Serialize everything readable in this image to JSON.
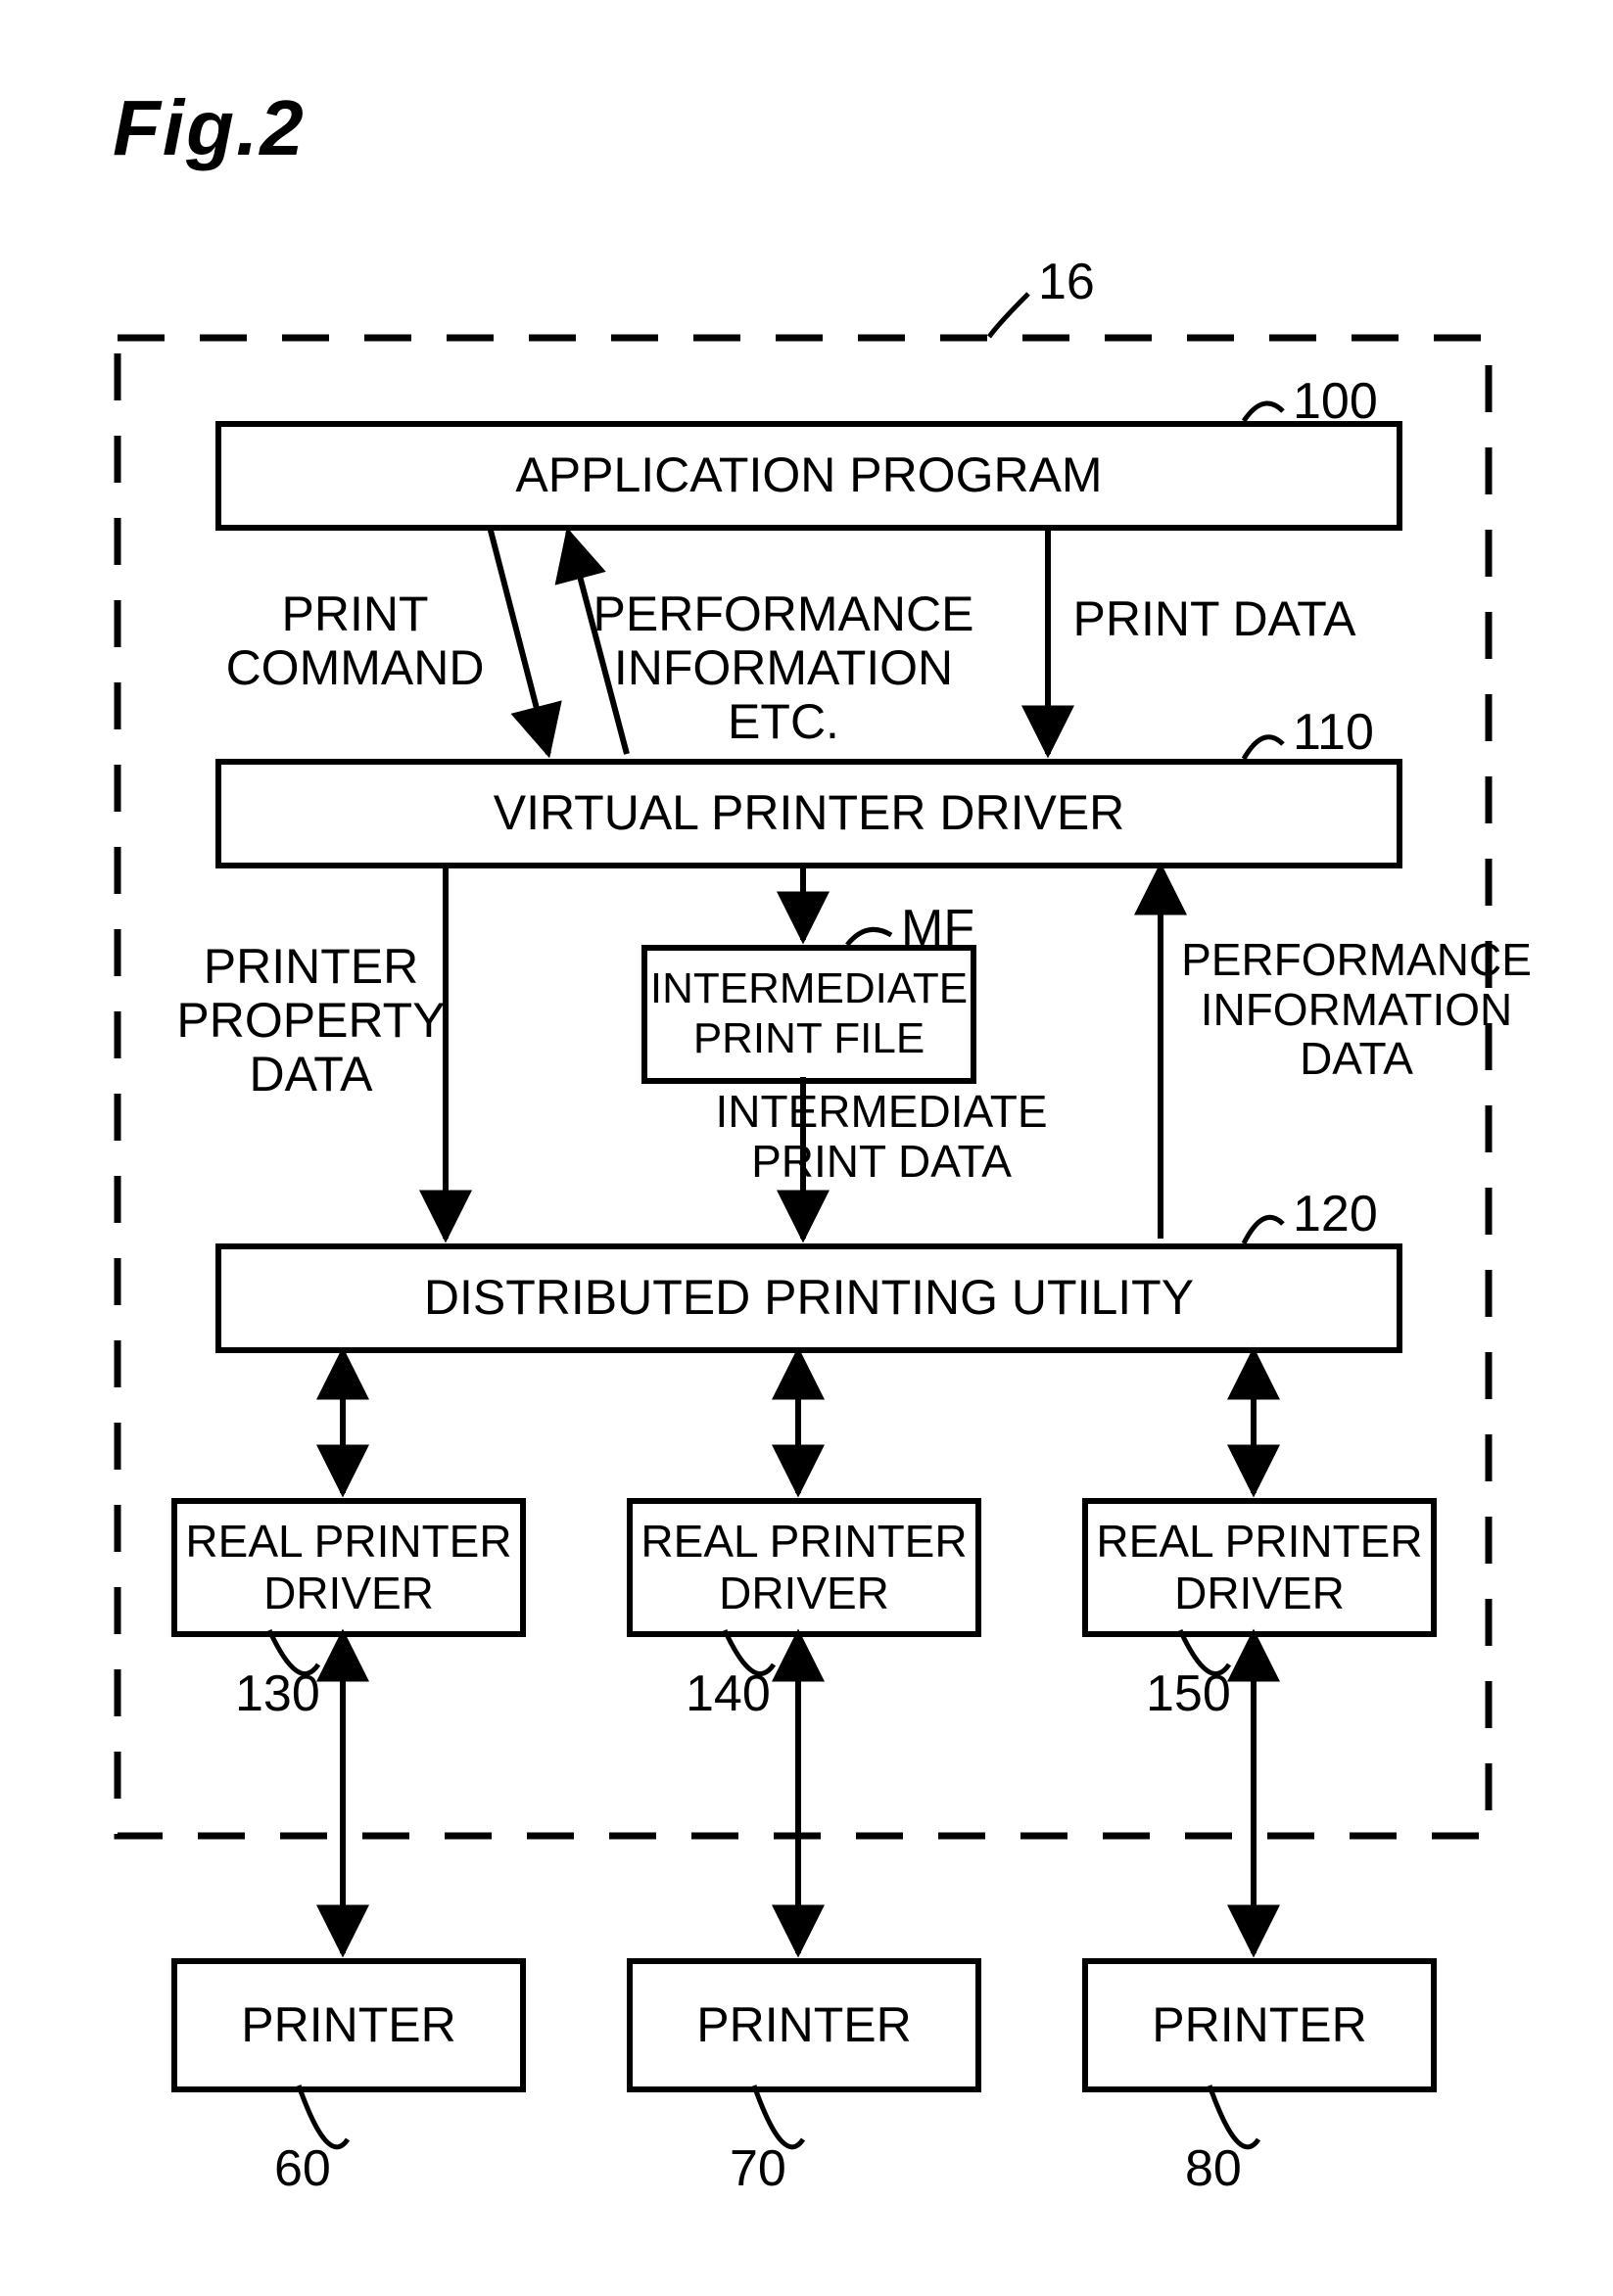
{
  "figure_title": "Fig.2",
  "container_ref": "16",
  "blocks": {
    "app": {
      "text": "APPLICATION PROGRAM",
      "ref": "100"
    },
    "vpd": {
      "text": "VIRTUAL PRINTER DRIVER",
      "ref": "110"
    },
    "ipf": {
      "text": "INTERMEDIATE PRINT FILE",
      "ref": "MF"
    },
    "dpu": {
      "text": "DISTRIBUTED PRINTING UTILITY",
      "ref": "120"
    },
    "rpd1": {
      "text": "REAL PRINTER DRIVER",
      "ref": "130"
    },
    "rpd2": {
      "text": "REAL PRINTER DRIVER",
      "ref": "140"
    },
    "rpd3": {
      "text": "REAL PRINTER DRIVER",
      "ref": "150"
    },
    "prn1": {
      "text": "PRINTER",
      "ref": "60"
    },
    "prn2": {
      "text": "PRINTER",
      "ref": "70"
    },
    "prn3": {
      "text": "PRINTER",
      "ref": "80"
    }
  },
  "edge_labels": {
    "print_command": "PRINT COMMAND",
    "perf_info_etc": "PERFORMANCE INFORMATION ETC.",
    "print_data": "PRINT DATA",
    "printer_property_data": "PRINTER PROPERTY DATA",
    "intermediate_print_data": "INTERMEDIATE PRINT DATA",
    "perf_info_data": "PERFORMANCE INFORMATION DATA"
  }
}
